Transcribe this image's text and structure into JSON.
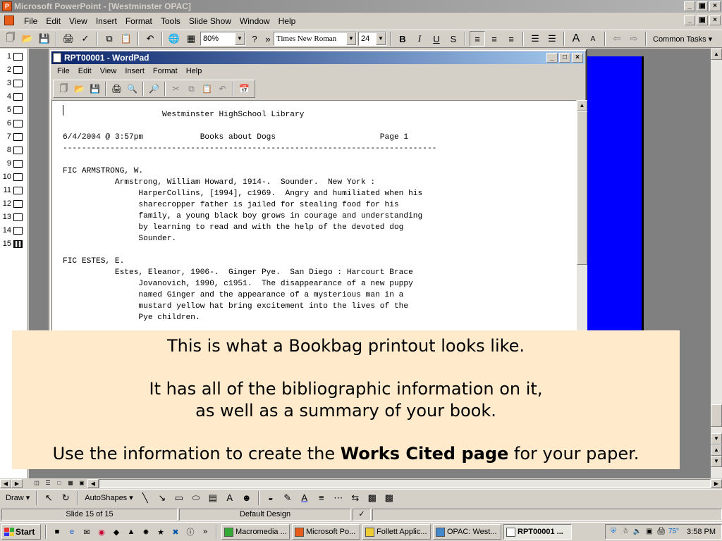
{
  "powerpoint": {
    "title": "Microsoft PowerPoint - [Westminster OPAC]",
    "menu": [
      "File",
      "Edit",
      "View",
      "Insert",
      "Format",
      "Tools",
      "Slide Show",
      "Window",
      "Help"
    ],
    "zoom": "80%",
    "font": "Times New Roman",
    "font_size": "24",
    "common_tasks": "Common Tasks ▾",
    "slide_numbers": [
      "1",
      "2",
      "3",
      "4",
      "5",
      "6",
      "7",
      "8",
      "9",
      "10",
      "11",
      "12",
      "13",
      "14",
      "15"
    ],
    "selected_slide": 15
  },
  "wordpad": {
    "title": "RPT00001 - WordPad",
    "menu": [
      "File",
      "Edit",
      "View",
      "Insert",
      "Format",
      "Help"
    ],
    "document": "                     Westminster HighSchool Library\n\n6/4/2004 @ 3:57pm            Books about Dogs                      Page 1\n-------------------------------------------------------------------------------\n\nFIC ARMSTRONG, W.\n           Armstrong, William Howard, 1914-.  Sounder.  New York :\n                HarperCollins, [1994], c1969.  Angry and humiliated when his\n                sharecropper father is jailed for stealing food for his\n                family, a young black boy grows in courage and understanding\n                by learning to read and with the help of the devoted dog\n                Sounder.\n\nFIC ESTES, E.\n           Estes, Eleanor, 1906-.  Ginger Pye.  San Diego : Harcourt Brace\n                Jovanovich, 1990, c1951.  The disappearance of a new puppy\n                named Ginger and the appearance of a mysterious man in a\n                mustard yellow hat bring excitement into the lives of the\n                Pye children."
  },
  "caption": {
    "line1": "This is what a Bookbag printout looks like.",
    "line2": "It has all of the bibliographic information on it,",
    "line3": "as well as a summary of your book.",
    "line4_before": "Use the information to create the ",
    "line4_bold": "Works Cited page",
    "line4_after": " for your paper."
  },
  "draw_toolbar": {
    "draw": "Draw ▾",
    "autoshapes": "AutoShapes ▾"
  },
  "status": {
    "slide": "Slide 15 of 15",
    "design": "Default Design"
  },
  "taskbar": {
    "start": "Start",
    "tasks": [
      "Macromedia ...",
      "Microsoft Po...",
      "Follett Applic...",
      "OPAC: West...",
      "RPT00001 ..."
    ],
    "time": "3:58 PM",
    "more": "»",
    "temp": "75°"
  },
  "colors": {
    "caption_bg": "#ffebcc",
    "slide_blue": "#0000ff",
    "wordpad_title": "#0a246a"
  }
}
